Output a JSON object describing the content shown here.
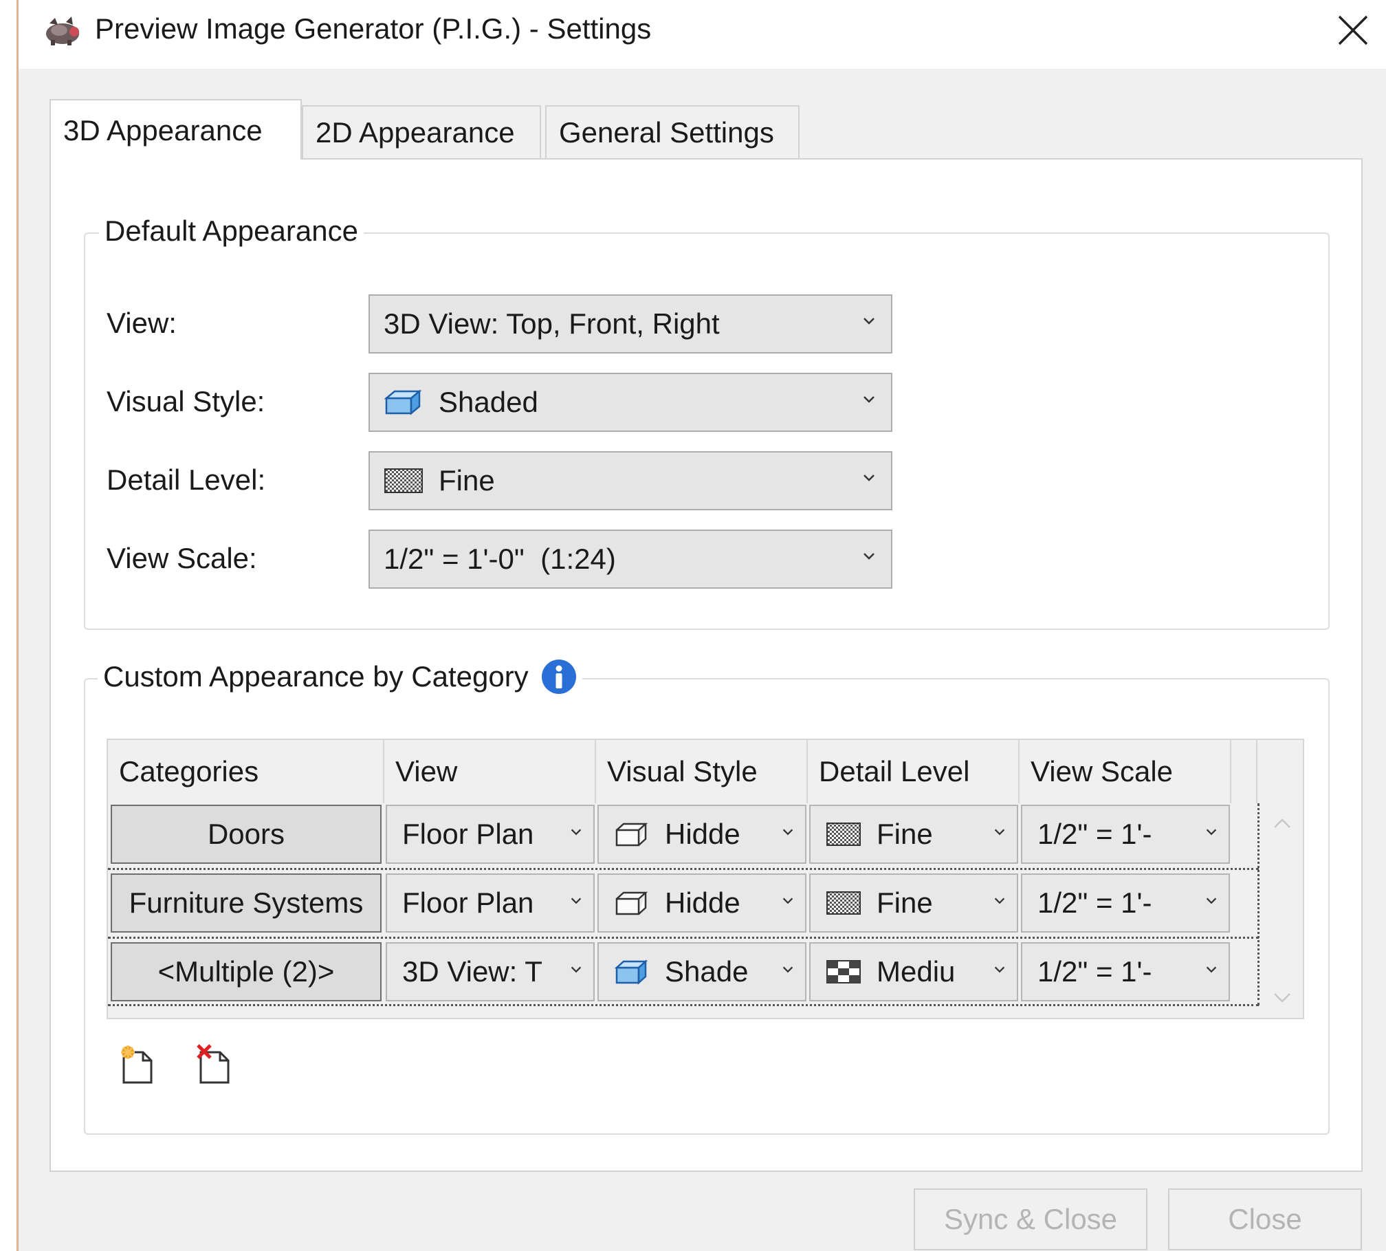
{
  "window": {
    "title": "Preview Image Generator (P.I.G.) - Settings"
  },
  "tabs": [
    {
      "label": "3D Appearance",
      "active": true
    },
    {
      "label": "2D Appearance",
      "active": false
    },
    {
      "label": "General Settings",
      "active": false
    }
  ],
  "default_appearance": {
    "legend": "Default Appearance",
    "view": {
      "label": "View:",
      "value": "3D View: Top, Front, Right"
    },
    "visual_style": {
      "label": "Visual Style:",
      "value": "Shaded",
      "icon": "shaded-cube-icon"
    },
    "detail_level": {
      "label": "Detail Level:",
      "value": "Fine",
      "icon": "fine-detail-icon"
    },
    "view_scale": {
      "label": "View Scale:",
      "value": "1/2\" = 1'-0\"  (1:24)"
    }
  },
  "custom_appearance": {
    "legend": "Custom Appearance by Category",
    "info_icon": "info-icon",
    "columns": [
      "Categories",
      "View",
      "Visual Style",
      "Detail Level",
      "View Scale"
    ],
    "rows": [
      {
        "category": "Doors",
        "view": "Floor Plan",
        "visual_style": "Hidde",
        "detail_level": "Fine",
        "view_scale": "1/2\" = 1'-"
      },
      {
        "category": "Furniture Systems",
        "view": "Floor Plan",
        "visual_style": "Hidde",
        "detail_level": "Fine",
        "view_scale": "1/2\" = 1'-"
      },
      {
        "category": "<Multiple (2)>",
        "view": "3D View: T",
        "visual_style": "Shade",
        "detail_level": "Mediu",
        "view_scale": "1/2\" = 1'-"
      }
    ],
    "toolbar_icons": [
      "add-category-icon",
      "remove-category-icon"
    ]
  },
  "buttons": {
    "sync_close": "Sync & Close",
    "close": "Close"
  },
  "colors": {
    "accent": "#1e6fd9",
    "info": "#2a6fd6",
    "disabled_text": "#b4b4b4"
  }
}
